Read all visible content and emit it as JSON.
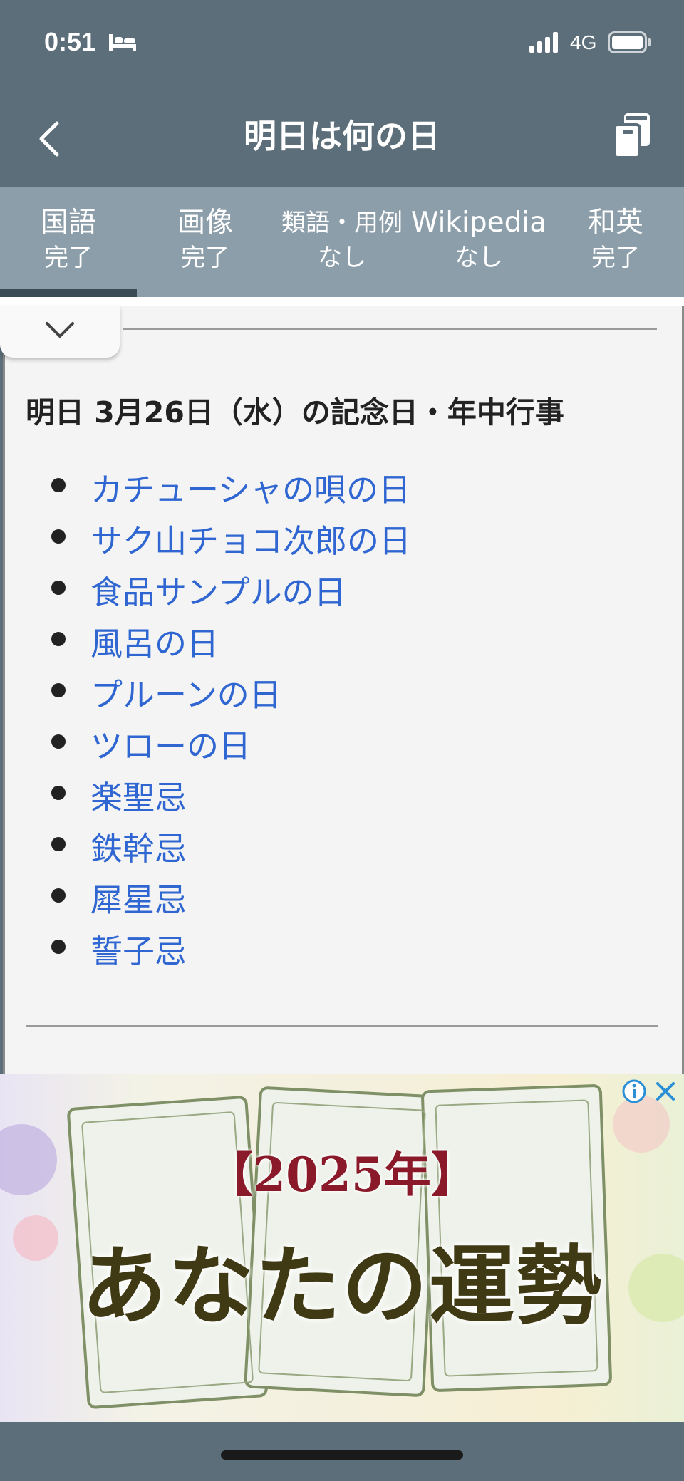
{
  "status_bar": {
    "time": "0:51",
    "network": "4G",
    "icons": [
      "bed-icon",
      "signal-icon",
      "battery-icon"
    ]
  },
  "nav": {
    "title": "明日は何の日",
    "back_icon": "chevron-left-icon",
    "copy_icon": "copy-icon"
  },
  "tabs": [
    {
      "label": "国語",
      "status": "完了"
    },
    {
      "label": "画像",
      "status": "完了"
    },
    {
      "label": "類語・用例",
      "status": "なし"
    },
    {
      "label": "Wikipedia",
      "status": "なし"
    },
    {
      "label": "和英",
      "status": "完了"
    }
  ],
  "active_tab_index": 0,
  "content": {
    "heading": "明日 3月26日（水）の記念日・年中行事",
    "events": [
      "カチューシャの唄の日",
      "サク山チョコ次郎の日",
      "食品サンプルの日",
      "風呂の日",
      "プルーンの日",
      "ツローの日",
      "楽聖忌",
      "鉄幹忌",
      "犀星忌",
      "誓子忌"
    ]
  },
  "ad": {
    "headline": "【2025年】",
    "title": "あなたの運勢"
  },
  "colors": {
    "header": "#5c6e79",
    "tab_bar": "#8c9ea9",
    "tab_active": "#3a4b56",
    "link": "#2f66d1",
    "panel": "#f4f4f4"
  }
}
